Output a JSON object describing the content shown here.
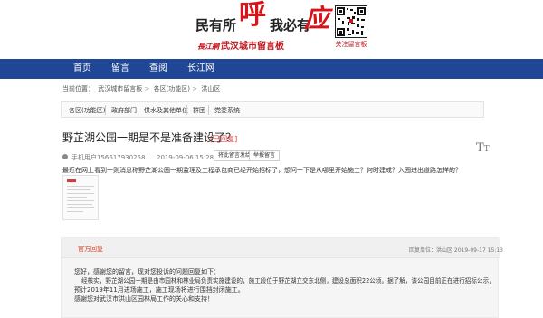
{
  "header": {
    "logo_left": "民有所",
    "logo_hu": "呼",
    "logo_right": "我必有",
    "logo_ying": "应",
    "logo_brand": "長江網",
    "logo_sub": "武汉城市留言板",
    "qr_label": "关注留言板"
  },
  "nav": {
    "items": [
      "首页",
      "留言",
      "查阅",
      "长江网"
    ]
  },
  "breadcrumb": {
    "prefix": "当前位置：",
    "items": [
      "武汉城市留言板",
      "各区(功能区)",
      "洪山区"
    ],
    "separator": ">"
  },
  "categories": [
    "各区(功能区)",
    "政府部门",
    "供水及其他单位",
    "群团",
    "党委系统"
  ],
  "post": {
    "title": "野芷湖公园一期是不是准备建设了？",
    "status": "[已回复]",
    "user": "手机用户156617930258…",
    "date": "2019-09-06 15:28",
    "btn_copy": "将此留言发给朋友",
    "btn_report": "举报留言",
    "content": "最近在网上看到一则消息称野芷湖公园一期监理及工程承包商已经开始招标了，想问一下是从哪里开始施工？何时建成？入园进出道路怎样的？"
  },
  "reply": {
    "tag": "官方回复",
    "meta": "回复单位：洪山区     2019-09-17 15:13",
    "lines": [
      "您好，感谢您的留言，现对您投诉的问题回复如下：",
      "经核实，野芷湖公园一期是由市园林和林业局负责实施建设的，施工段位于野芷湖立交东北侧，建设总面积22公顷。据了解，该公园目前正在进行招标公示，",
      "预计2019年11月进场施工，施工现场将进行围挡封闭施工。",
      "感谢您对武汉市洪山区园林局工作的关心和支持！"
    ]
  },
  "icons": {
    "qr": "qr-code-icon",
    "avatar": "user-avatar-icon",
    "attachment": "document-thumbnail",
    "font_size": "text-size-icon"
  },
  "colors": {
    "nav_bg": "#1f4795",
    "logo_red": "#d8141b",
    "status_red": "#d73a3a",
    "official_tag": "#d6442a"
  }
}
